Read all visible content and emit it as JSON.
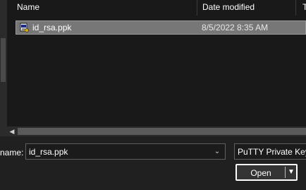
{
  "columns": {
    "name": "Name",
    "date_modified": "Date modified",
    "type_partial": "T"
  },
  "files": [
    {
      "name": "id_rsa.ppk",
      "date_modified": "8/5/2022 8:35 AM",
      "icon": "putty-key-icon",
      "selected": true
    }
  ],
  "file_name": {
    "label": "name:",
    "value": "id_rsa.ppk",
    "dropdown_icon": "chevron-down-icon"
  },
  "file_type": {
    "value": "PuTTY Private Key"
  },
  "open_button": {
    "label": "Open",
    "split_icon": "triangle-down-icon"
  },
  "scrollbar": {
    "left_arrow_icon": "triangle-left-icon"
  },
  "colors": {
    "background": "#191919",
    "selected_row": "#777777",
    "panel": "#202020"
  }
}
